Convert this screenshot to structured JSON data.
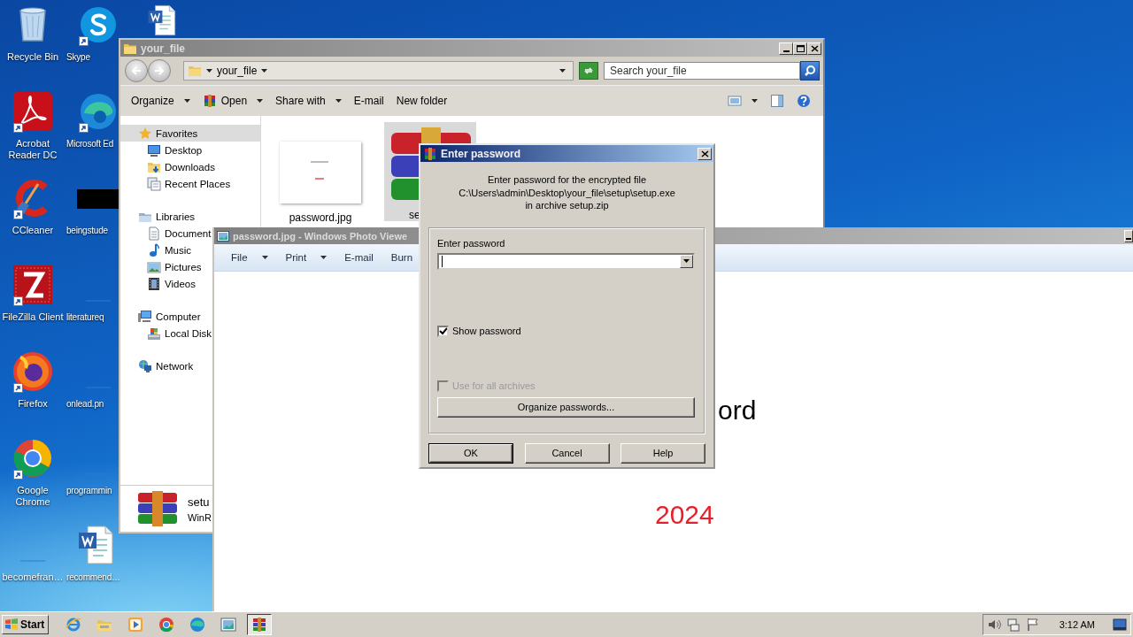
{
  "desktop": {
    "icons": [
      {
        "label": "Recycle Bin",
        "kind": "recycle",
        "shortcut": false
      },
      {
        "label": "Acrobat Reader DC",
        "kind": "acrobat",
        "shortcut": true
      },
      {
        "label": "CCleaner",
        "kind": "ccleaner",
        "shortcut": true
      },
      {
        "label": "FileZilla Client",
        "kind": "filezilla",
        "shortcut": true
      },
      {
        "label": "Firefox",
        "kind": "firefox",
        "shortcut": true
      },
      {
        "label": "Google Chrome",
        "kind": "chrome",
        "shortcut": true
      },
      {
        "label": "becomefran…",
        "kind": "blank",
        "shortcut": false
      },
      {
        "label": "Skype",
        "kind": "skype",
        "shortcut": true
      },
      {
        "label": "Microsoft Ed",
        "kind": "edge",
        "shortcut": true
      },
      {
        "label": "beingstude",
        "kind": "blackimage",
        "shortcut": false
      },
      {
        "label": "literatureq",
        "kind": "blank",
        "shortcut": false
      },
      {
        "label": "onlead.pn",
        "kind": "blank",
        "shortcut": false
      },
      {
        "label": "programmin",
        "kind": "blank",
        "shortcut": false
      },
      {
        "label": "recommend…",
        "kind": "word",
        "shortcut": false
      },
      {
        "kind": "word",
        "shortcut": false
      }
    ]
  },
  "explorer": {
    "title": "your_file",
    "breadcrumb": [
      "your_file"
    ],
    "search": {
      "placeholder": "Search your_file"
    },
    "commands": [
      {
        "label": "Organize",
        "kind": "plain",
        "dropdown": true
      },
      {
        "label": "Open",
        "kind": "winrar",
        "dropdown": true
      },
      {
        "label": "Share with",
        "kind": "plain",
        "dropdown": true
      },
      {
        "label": "E-mail",
        "kind": "plain",
        "dropdown": false
      },
      {
        "label": "New folder",
        "kind": "plain",
        "dropdown": false
      }
    ],
    "nav": [
      {
        "label": "Favorites",
        "kind": "star",
        "selected": true,
        "children": [
          {
            "label": "Desktop",
            "kind": "desktop",
            "selected": false
          },
          {
            "label": "Downloads",
            "kind": "downloads",
            "selected": false
          },
          {
            "label": "Recent Places",
            "kind": "recent",
            "selected": false
          }
        ]
      },
      {
        "label": "Libraries",
        "kind": "libraries",
        "selected": false,
        "children": [
          {
            "label": "Document",
            "kind": "documents",
            "selected": false
          },
          {
            "label": "Music",
            "kind": "music",
            "selected": false
          },
          {
            "label": "Pictures",
            "kind": "pictures",
            "selected": false
          },
          {
            "label": "Videos",
            "kind": "videos",
            "selected": false
          }
        ]
      },
      {
        "label": "Computer",
        "kind": "computer",
        "selected": false,
        "children": [
          {
            "label": "Local Disk",
            "kind": "disk",
            "selected": false
          }
        ]
      },
      {
        "label": "Network",
        "kind": "network",
        "selected": false
      }
    ],
    "files": [
      {
        "name": "password.jpg",
        "kind": "image",
        "selected": false
      },
      {
        "name": "se",
        "kind": "winrar",
        "selected": true
      }
    ],
    "details": {
      "name": "setu",
      "type": "WinR"
    }
  },
  "photo_viewer": {
    "title": "password.jpg - Windows Photo Viewe",
    "menu": [
      {
        "label": "File",
        "dropdown": true
      },
      {
        "label": "Print",
        "dropdown": true
      },
      {
        "label": "E-mail",
        "dropdown": false
      },
      {
        "label": "Burn",
        "dropdown": false
      }
    ],
    "image_text": [
      {
        "text": "ord",
        "color": "#000000"
      },
      {
        "text": "2024",
        "color": "#e8202a"
      }
    ]
  },
  "dialog": {
    "title": "Enter password",
    "message": [
      "Enter password for the encrypted file",
      "C:\\Users\\admin\\Desktop\\your_file\\setup\\setup.exe",
      "in archive setup.zip"
    ],
    "password_label": "Enter password",
    "options": [
      {
        "label": "Show password",
        "checked": true,
        "disabled": false
      },
      {
        "label": "Use for all archives",
        "checked": false,
        "disabled": true
      }
    ],
    "organize_button": "Organize passwords...",
    "buttons": [
      {
        "label": "OK",
        "default": true
      },
      {
        "label": "Cancel",
        "default": false
      },
      {
        "label": "Help",
        "default": false
      }
    ]
  },
  "taskbar": {
    "start": "Start",
    "apps": [
      {
        "kind": "ie",
        "active": false
      },
      {
        "kind": "explorer",
        "active": false
      },
      {
        "kind": "media",
        "active": false
      },
      {
        "kind": "chrome",
        "active": false
      },
      {
        "kind": "edge",
        "active": false
      },
      {
        "kind": "photo",
        "active": false
      },
      {
        "kind": "winrar",
        "active": true
      }
    ],
    "time": "3:12 AM"
  }
}
